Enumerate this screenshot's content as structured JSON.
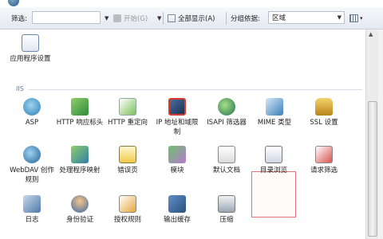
{
  "toolbar": {
    "filter_label": "筛选:",
    "filter_value": "",
    "start_label": "开始(G)",
    "show_all_label": "全部显示(A)",
    "group_label": "分组依据:",
    "group_value": "区域",
    "dropdown_glyph": "▼",
    "view_glyph": "▾"
  },
  "sections": {
    "iis": "IIS"
  },
  "tiles": {
    "app_settings": "应用程序设置",
    "asp": "ASP",
    "http_response": "HTTP 响应标头",
    "http_redirect": "HTTP 重定向",
    "ip_domain": "IP 地址和域限制",
    "isapi": "ISAPI 筛选器",
    "mime": "MIME 类型",
    "ssl": "SSL 设置",
    "webdav": "WebDAV 创作规则",
    "handler": "处理程序映射",
    "error_pages": "错误页",
    "modules": "模块",
    "default_doc": "默认文档",
    "dir_browse": "目录浏览",
    "request_filter": "请求筛选",
    "logging": "日志",
    "auth": "身份验证",
    "authz": "授权规则",
    "output_cache": "输出缓存",
    "compression": "压缩"
  },
  "colors": {
    "selection_border": "#e57373",
    "section_blue": "#5a7fb0"
  }
}
